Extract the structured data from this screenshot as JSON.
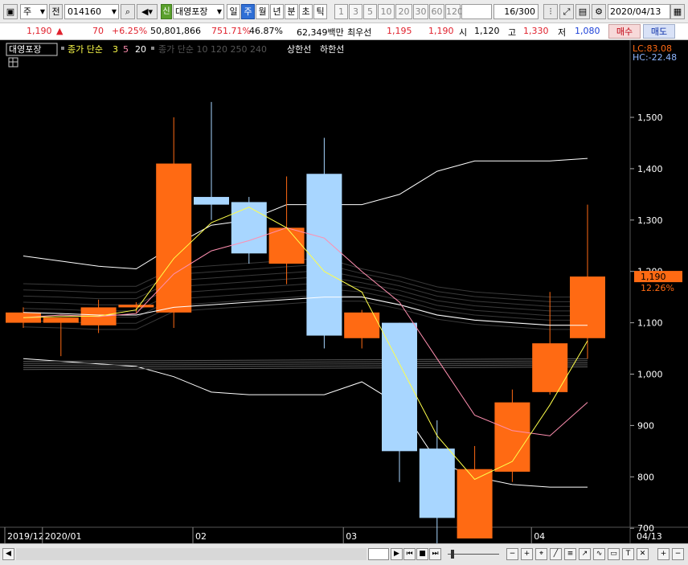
{
  "toolbar": {
    "market": "주",
    "scope": "전",
    "code": "014160",
    "badge": "신",
    "name": "대영포장",
    "periods": [
      "일",
      "주",
      "월",
      "년",
      "분",
      "초",
      "틱"
    ],
    "active_period": "주",
    "intervals": [
      "1",
      "3",
      "5",
      "10",
      "20",
      "30",
      "60",
      "120"
    ],
    "count": "16",
    "total": "/300",
    "date": "2020/04/13"
  },
  "quote": {
    "price": "1,190",
    "arrow": "▲",
    "change": "70",
    "change_pct": "+6.25%",
    "volume": "50,801,866",
    "vol_ratio": "751.71%",
    "turnover": "46.87%",
    "amount": "62,349백만",
    "best_label": "최우선",
    "ask": "1,195",
    "bid": "1,190",
    "open_label": "시",
    "open": "1,120",
    "high_label": "고",
    "high": "1,330",
    "low_label": "저",
    "low": "1,080",
    "buy": "매수",
    "sell": "매도"
  },
  "legend": {
    "name": "대영포장",
    "ma_label": "종가 단순",
    "ma_periods": [
      "3",
      "5",
      "20"
    ],
    "ma_hidden": "종가 단순 10  120  250  240",
    "upper": "상한선",
    "lower": "하한선",
    "lc": "LC:83.08",
    "hc": "HC:-22.48"
  },
  "price_tag": {
    "price": "1,190",
    "pct": "12.26%"
  },
  "colors": {
    "up": "#ff6a13",
    "down": "#a8d6ff",
    "ma3": "#ffff4a",
    "ma5": "#ff8fb0",
    "ma20": "#ffffff"
  },
  "chart_data": {
    "type": "candlestick",
    "y_ticks": [
      "1,500",
      "1,400",
      "1,300",
      "1,200",
      "1,100",
      "1,000",
      "900",
      "800",
      "700"
    ],
    "ylim": [
      640,
      1550
    ],
    "x_labels": [
      {
        "i": 0,
        "text": "2019/12"
      },
      {
        "i": 1,
        "text": "2020/01"
      },
      {
        "i": 5,
        "text": "02"
      },
      {
        "i": 9,
        "text": "03"
      },
      {
        "i": 14,
        "text": "04"
      }
    ],
    "right_date": "04/13",
    "candles": [
      {
        "o": 1100,
        "h": 1130,
        "l": 1090,
        "c": 1120
      },
      {
        "o": 1100,
        "h": 1110,
        "l": 1035,
        "c": 1110
      },
      {
        "o": 1095,
        "h": 1145,
        "l": 1080,
        "c": 1130
      },
      {
        "o": 1130,
        "h": 1140,
        "l": 1120,
        "c": 1135
      },
      {
        "o": 1120,
        "h": 1500,
        "l": 1090,
        "c": 1410
      },
      {
        "o": 1345,
        "h": 1530,
        "l": 1300,
        "c": 1330
      },
      {
        "o": 1335,
        "h": 1345,
        "l": 1215,
        "c": 1235
      },
      {
        "o": 1215,
        "h": 1385,
        "l": 1175,
        "c": 1285
      },
      {
        "o": 1390,
        "h": 1460,
        "l": 1050,
        "c": 1075
      },
      {
        "o": 1070,
        "h": 1125,
        "l": 1050,
        "c": 1120
      },
      {
        "o": 1100,
        "h": 1100,
        "l": 790,
        "c": 850
      },
      {
        "o": 855,
        "h": 910,
        "l": 660,
        "c": 720
      },
      {
        "o": 680,
        "h": 860,
        "l": 680,
        "c": 815
      },
      {
        "o": 810,
        "h": 970,
        "l": 790,
        "c": 945
      },
      {
        "o": 965,
        "h": 1160,
        "l": 960,
        "c": 1060
      },
      {
        "o": 1070,
        "h": 1330,
        "l": 1030,
        "c": 1190
      }
    ],
    "ma3": [
      1110,
      1112,
      1113,
      1125,
      1225,
      1295,
      1325,
      1285,
      1200,
      1160,
      1020,
      880,
      795,
      830,
      940,
      1065
    ],
    "ma5": [
      1110,
      1115,
      1112,
      1118,
      1195,
      1240,
      1260,
      1285,
      1265,
      1200,
      1140,
      1030,
      920,
      890,
      880,
      945
    ],
    "ma20": [
      1120,
      1118,
      1115,
      1115,
      1130,
      1135,
      1140,
      1145,
      1150,
      1150,
      1135,
      1115,
      1105,
      1100,
      1095,
      1095
    ],
    "upper_band": [
      1230,
      1220,
      1210,
      1205,
      1250,
      1290,
      1300,
      1330,
      1330,
      1330,
      1350,
      1395,
      1415,
      1415,
      1415,
      1420
    ],
    "lower_band": [
      1030,
      1025,
      1020,
      1015,
      995,
      965,
      960,
      960,
      960,
      985,
      940,
      830,
      800,
      785,
      780,
      780
    ]
  }
}
